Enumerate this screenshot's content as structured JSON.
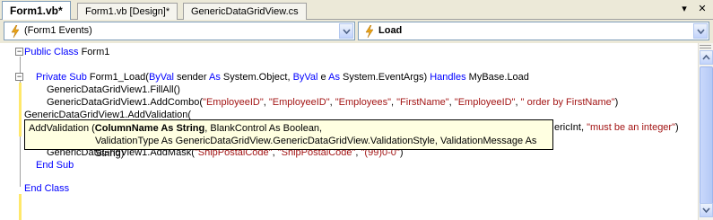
{
  "tabs": [
    {
      "label": "Form1.vb*",
      "active": true
    },
    {
      "label": "Form1.vb [Design]*",
      "active": false
    },
    {
      "label": "GenericDataGridView.cs",
      "active": false
    }
  ],
  "tab_controls": {
    "scroll": "▾",
    "close": "✕"
  },
  "dropdowns": {
    "left": {
      "value": "(Form1 Events)",
      "icon": "lightning-icon"
    },
    "right": {
      "value": "Load",
      "icon": "lightning-icon"
    }
  },
  "code": {
    "line1_kw": "Public Class",
    "line1_rest": " Form1",
    "line2_kw1": "Private Sub",
    "line2_a": " Form1_Load(",
    "line2_kw2": "ByVal",
    "line2_b": " sender ",
    "line2_kw3": "As",
    "line2_c": " System.Object, ",
    "line2_kw4": "ByVal",
    "line2_d": " e ",
    "line2_kw5": "As",
    "line2_e": " System.EventArgs) ",
    "line2_kw6": "Handles",
    "line2_f": " MyBase.Load",
    "line3": "GenericDataGridView1.FillAll()",
    "line4_a": "GenericDataGridView1.AddCombo(",
    "line4_s1": "\"EmployeeID\"",
    "line4_c1": ", ",
    "line4_s2": "\"EmployeeID\"",
    "line4_c2": ", ",
    "line4_s3": "\"Employees\"",
    "line4_c3": ", ",
    "line4_s4": "\"FirstName\"",
    "line4_c4": ", ",
    "line4_s5": "\"EmployeeID\"",
    "line4_c5": ", ",
    "line4_s6": "\" order by FirstName\"",
    "line4_end": ")",
    "line5": "GenericDataGridView1.AddValidation(",
    "line6_tail_a": "ericInt, ",
    "line6_tail_s": "\"must be an integer\"",
    "line6_tail_b": ")",
    "line7_a": "GenericDataGridView1.AddMask(",
    "line7_s1": "\"ShipPostalCode\"",
    "line7_c1": ", ",
    "line7_s2": "\"ShipPostalCode\"",
    "line7_c2": ", ",
    "line7_s3": "\"(99)0-0\"",
    "line7_end": ")",
    "line8_kw": "End Sub",
    "line9_kw": "End Class"
  },
  "tooltip": {
    "line1_a": "AddValidation (",
    "line1_bold": "ColumnName As String",
    "line1_b": ", BlankControl As Boolean,",
    "line2": "ValidationType As GenericDataGridView.GenericDataGridView.ValidationStyle, ValidationMessage As String)"
  },
  "colors": {
    "keyword": "#0000ff",
    "string": "#a31515",
    "tooltip_bg": "#ffffe1",
    "change_bar": "#ffe86b"
  }
}
